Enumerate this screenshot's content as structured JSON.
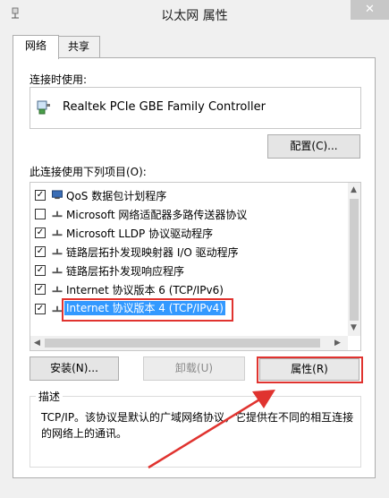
{
  "window": {
    "title": "以太网 属性",
    "close_glyph": "✕"
  },
  "tabs": [
    {
      "label": "网络"
    },
    {
      "label": "共享"
    }
  ],
  "connect_using": {
    "label": "连接时使用:",
    "device": "Realtek PCIe GBE Family Controller",
    "configure_button": "配置(C)..."
  },
  "items_section": {
    "label": "此连接使用下列项目(O):",
    "items": [
      {
        "label": "QoS 数据包计划程序",
        "checked": true,
        "icon": "qos-icon"
      },
      {
        "label": "Microsoft 网络适配器多路传送器协议",
        "checked": false,
        "icon": "protocol-icon"
      },
      {
        "label": "Microsoft LLDP 协议驱动程序",
        "checked": true,
        "icon": "protocol-icon"
      },
      {
        "label": "链路层拓扑发现映射器 I/O 驱动程序",
        "checked": true,
        "icon": "protocol-icon"
      },
      {
        "label": "链路层拓扑发现响应程序",
        "checked": true,
        "icon": "protocol-icon"
      },
      {
        "label": "Internet 协议版本 6 (TCP/IPv6)",
        "checked": true,
        "icon": "protocol-icon"
      },
      {
        "label": "Internet 协议版本 4 (TCP/IPv4)",
        "checked": true,
        "icon": "protocol-icon",
        "selected": true
      }
    ]
  },
  "buttons": {
    "install": "安装(N)...",
    "uninstall": "卸载(U)",
    "properties": "属性(R)"
  },
  "description": {
    "legend": "描述",
    "text": "TCP/IP。该协议是默认的广域网络协议，它提供在不同的相互连接的网络上的通讯。"
  },
  "colors": {
    "selection": "#3399ff",
    "annotation": "#e0332f"
  }
}
